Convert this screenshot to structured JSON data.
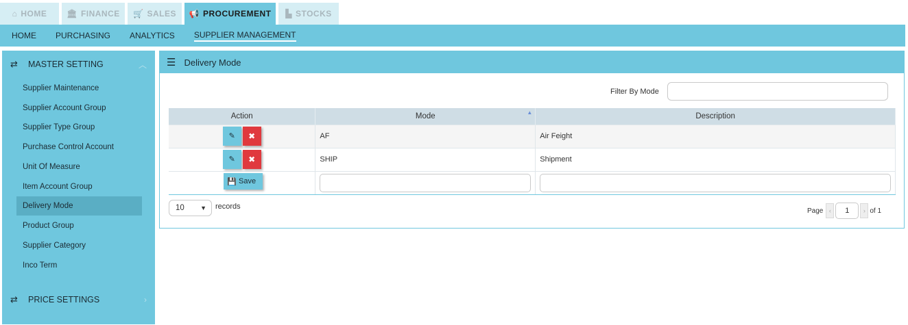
{
  "top_tabs": [
    {
      "label": "HOME",
      "icon": "home-icon"
    },
    {
      "label": "FINANCE",
      "icon": "bank-icon"
    },
    {
      "label": "SALES",
      "icon": "cart-icon"
    },
    {
      "label": "PROCUREMENT",
      "icon": "bullhorn-icon",
      "active": true
    },
    {
      "label": "STOCKS",
      "icon": "bar-chart-icon"
    }
  ],
  "subnav": [
    {
      "label": "HOME"
    },
    {
      "label": "PURCHASING"
    },
    {
      "label": "ANALYTICS"
    },
    {
      "label": "SUPPLIER MANAGEMENT",
      "active": true
    }
  ],
  "sidebar": {
    "master_title": "MASTER SETTING",
    "items": [
      {
        "label": "Supplier Maintenance"
      },
      {
        "label": "Supplier Account Group"
      },
      {
        "label": "Supplier Type Group"
      },
      {
        "label": "Purchase Control Account"
      },
      {
        "label": "Unit Of Measure"
      },
      {
        "label": "Item Account Group"
      },
      {
        "label": "Delivery Mode",
        "active": true
      },
      {
        "label": "Product Group"
      },
      {
        "label": "Supplier Category"
      },
      {
        "label": "Inco Term"
      }
    ],
    "price_title": "PRICE SETTINGS"
  },
  "panel": {
    "title": "Delivery Mode",
    "filter_label": "Filter By Mode",
    "filter_value": ""
  },
  "table": {
    "headers": {
      "action": "Action",
      "mode": "Mode",
      "description": "Description"
    },
    "rows": [
      {
        "mode": "AF",
        "description": "Air Feight"
      },
      {
        "mode": "SHIP",
        "description": "Shipment"
      }
    ],
    "save_label": "Save"
  },
  "footer": {
    "page_size": "10",
    "records_label": "records",
    "page_label": "Page",
    "current_page": "1",
    "of_label": "of 1"
  },
  "colors": {
    "accent": "#6fc7de",
    "danger": "#e0393e",
    "header_row": "#cfdde5"
  }
}
